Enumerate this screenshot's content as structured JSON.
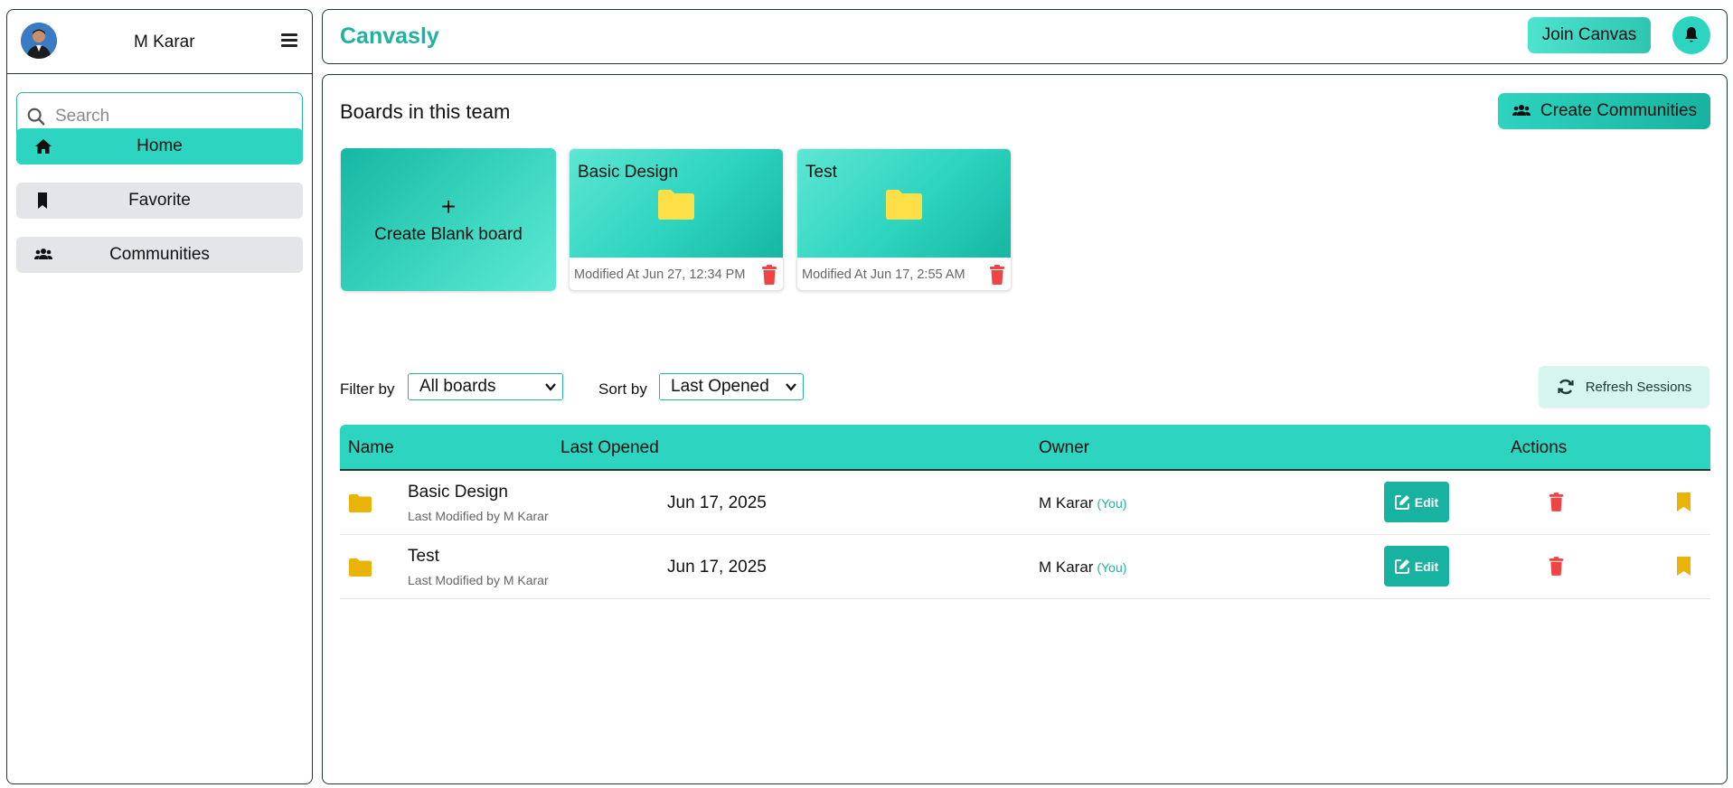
{
  "sidebar": {
    "user_name": "M Karar",
    "search_placeholder": "Search",
    "items": [
      {
        "label": "Home",
        "icon": "home-icon",
        "active": true
      },
      {
        "label": "Favorite",
        "icon": "bookmark-icon",
        "active": false
      },
      {
        "label": "Communities",
        "icon": "users-icon",
        "active": false
      }
    ]
  },
  "header": {
    "brand": "Canvasly",
    "join_label": "Join Canvas",
    "bell_icon": "bell-icon"
  },
  "main": {
    "section_title": "Boards in this team",
    "create_communities_label": "Create Communities",
    "blank_card": {
      "plus": "+",
      "label": "Create Blank board"
    },
    "cards": [
      {
        "title": "Basic Design",
        "modified": "Modified At Jun 27, 12:34 PM"
      },
      {
        "title": "Test",
        "modified": "Modified At Jun 17, 2:55 AM"
      }
    ],
    "filter": {
      "label": "Filter by",
      "value": "All boards"
    },
    "sort": {
      "label": "Sort by",
      "value": "Last Opened"
    },
    "refresh_label": "Refresh Sessions",
    "table": {
      "headers": {
        "name": "Name",
        "last_opened": "Last Opened",
        "owner": "Owner",
        "actions": "Actions"
      },
      "rows": [
        {
          "name": "Basic Design",
          "modified_by": "Last Modified by M Karar",
          "date": "Jun 17, 2025",
          "owner": "M Karar",
          "you": "(You)",
          "edit": "Edit"
        },
        {
          "name": "Test",
          "modified_by": "Last Modified by M Karar",
          "date": "Jun 17, 2025",
          "owner": "M Karar",
          "you": "(You)",
          "edit": "Edit"
        }
      ]
    }
  },
  "colors": {
    "accent": "#2dd4bf",
    "accent_dark": "#17b3a0",
    "brand": "#20b2a0",
    "danger": "#ef4444",
    "folder": "#eab308"
  }
}
